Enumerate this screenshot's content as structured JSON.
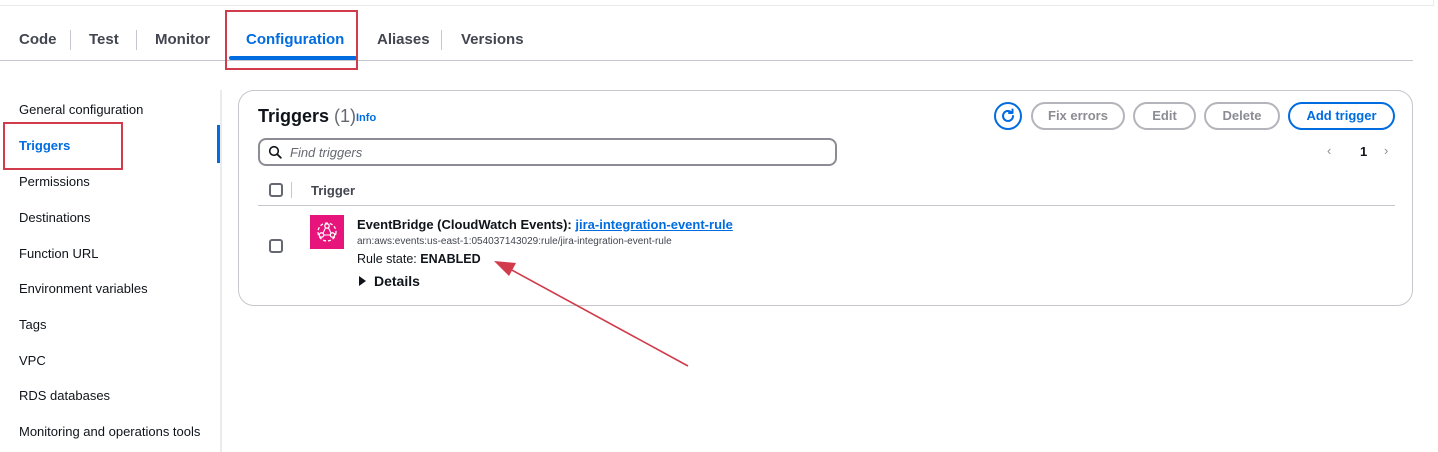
{
  "tabs": [
    {
      "label": "Code"
    },
    {
      "label": "Test"
    },
    {
      "label": "Monitor"
    },
    {
      "label": "Configuration",
      "active": true
    },
    {
      "label": "Aliases"
    },
    {
      "label": "Versions"
    }
  ],
  "sidebar": {
    "items": [
      {
        "label": "General configuration"
      },
      {
        "label": "Triggers",
        "active": true
      },
      {
        "label": "Permissions"
      },
      {
        "label": "Destinations"
      },
      {
        "label": "Function URL"
      },
      {
        "label": "Environment variables"
      },
      {
        "label": "Tags"
      },
      {
        "label": "VPC"
      },
      {
        "label": "RDS databases"
      },
      {
        "label": "Monitoring and operations tools"
      }
    ]
  },
  "panel": {
    "title": "Triggers",
    "count": "(1)",
    "info": "Info",
    "buttons": {
      "fix_errors": "Fix errors",
      "edit": "Edit",
      "delete": "Delete",
      "add_trigger": "Add trigger"
    },
    "search": {
      "placeholder": "Find triggers",
      "value": ""
    },
    "pagination": {
      "prev": "‹",
      "page": "1",
      "next": "›"
    },
    "column_header": "Trigger",
    "rows": [
      {
        "source": "EventBridge (CloudWatch Events):",
        "rule_name": "jira-integration-event-rule",
        "arn": "arn:aws:events:us-east-1:054037143029:rule/jira-integration-event-rule",
        "state_label": "Rule state:",
        "state_value": "ENABLED",
        "details": "Details"
      }
    ]
  },
  "colors": {
    "accent": "#006ce0",
    "eventbridge": "#e7157b",
    "highlight": "#d13b4b"
  }
}
